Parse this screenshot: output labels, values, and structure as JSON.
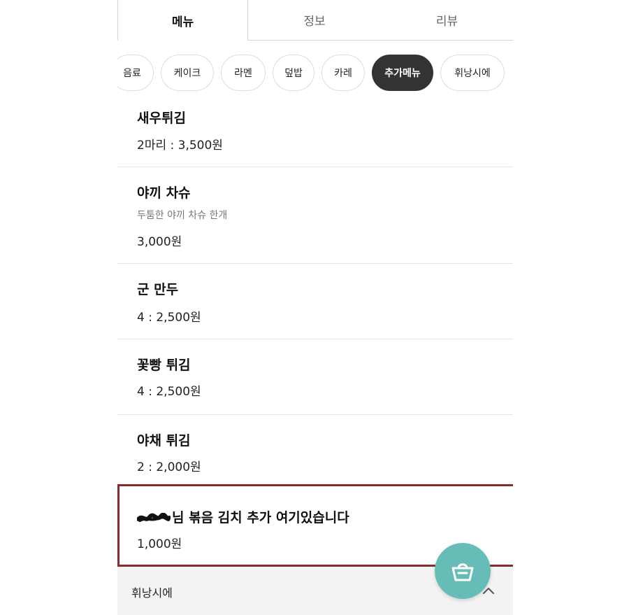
{
  "tabs": [
    {
      "label": "메뉴",
      "active": true
    },
    {
      "label": "정보",
      "active": false
    },
    {
      "label": "리뷰",
      "active": false
    }
  ],
  "categories": [
    {
      "label": "음료"
    },
    {
      "label": "케이크"
    },
    {
      "label": "라멘"
    },
    {
      "label": "덮밥"
    },
    {
      "label": "카레"
    },
    {
      "label": "추가메뉴",
      "active": true
    },
    {
      "label": "휘낭시에"
    }
  ],
  "menu_items": [
    {
      "name": "새우튀김",
      "price": "2마리 : 3,500원"
    },
    {
      "name": "야끼 차슈",
      "desc": "두툼한 야끼 차슈 한개",
      "price": "3,000원"
    },
    {
      "name": "군 만두",
      "price": "4 : 2,500원"
    },
    {
      "name": "꽃빵 튀김",
      "price": "4 : 2,500원"
    },
    {
      "name": "야채 튀김",
      "price": "2 : 2,000원"
    },
    {
      "name": "님 볶음 김치 추가 여기있습니다",
      "price": "1,000원"
    }
  ],
  "footer": {
    "label": "휘낭시에"
  },
  "colors": {
    "active_chip": "#333333",
    "highlight_border": "#8b2c2c",
    "cart_button": "#66bdb7"
  },
  "icons": {
    "cart": "shopping-basket-icon",
    "footer_toggle": "chevron-up-icon"
  }
}
